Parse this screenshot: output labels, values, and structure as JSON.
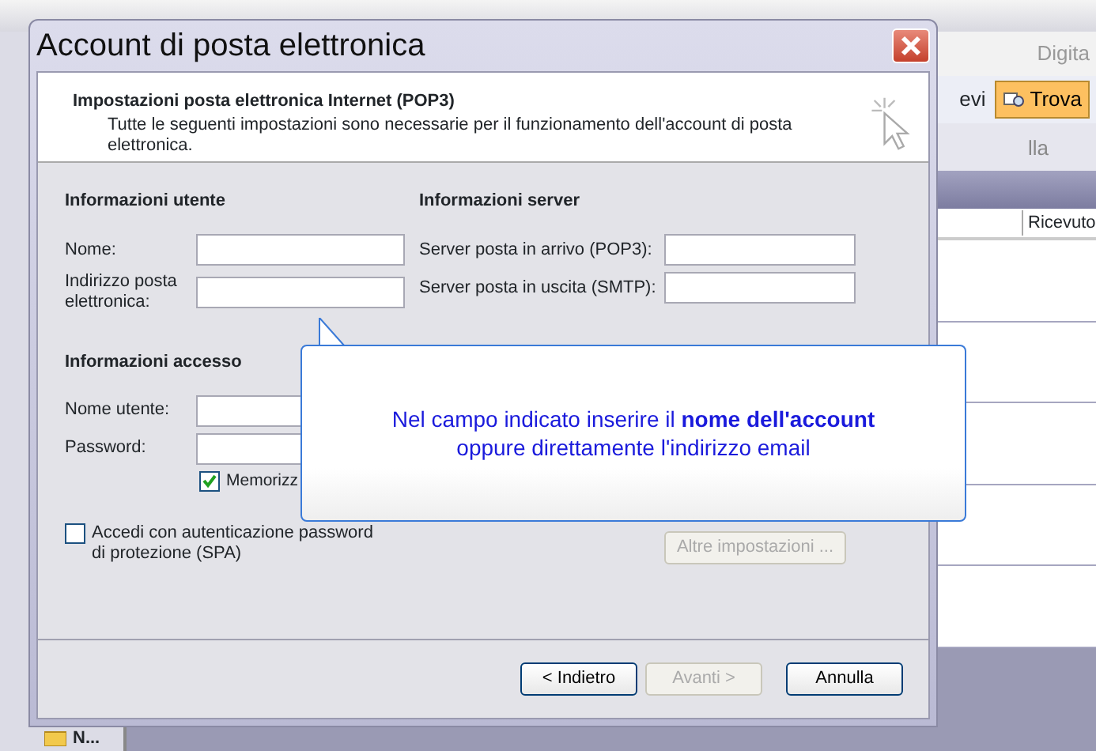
{
  "background_app": {
    "search_text": "Digita",
    "toolbar_item": "evi",
    "find_button": "Trova",
    "row_text": "lla",
    "column_header": "Ricevuto",
    "folder_label": "N..."
  },
  "window": {
    "title": "Account di posta elettronica"
  },
  "header": {
    "title": "Impostazioni posta elettronica Internet (POP3)",
    "subtitle": "Tutte le seguenti impostazioni sono necessarie per il funzionamento dell'account di posta elettronica."
  },
  "user_section": {
    "title": "Informazioni utente",
    "fields": [
      {
        "label": "Nome:"
      },
      {
        "label": "Indirizzo posta elettronica:"
      }
    ]
  },
  "server_section": {
    "title": "Informazioni server",
    "fields": [
      {
        "label": "Server posta in arrivo (POP3):"
      },
      {
        "label": "Server posta in uscita (SMTP):"
      }
    ]
  },
  "access_section": {
    "title": "Informazioni accesso",
    "fields": [
      {
        "label": "Nome utente:"
      },
      {
        "label": "Password:"
      }
    ],
    "remember": {
      "label": "Memorizz",
      "checked": true
    }
  },
  "spa": {
    "label": "Accedi con autenticazione password di protezione (SPA)",
    "checked": false
  },
  "more_settings": {
    "label": "Altre impostazioni ...",
    "disabled": true
  },
  "buttons": [
    {
      "label": "< Indietro",
      "disabled": false
    },
    {
      "label": "Avanti >",
      "disabled": true
    },
    {
      "label": "Annulla",
      "disabled": false
    }
  ],
  "callout": {
    "text": "Nel campo indicato inserire il **nome dell'account**\noppure direttamente l'indirizzo email"
  }
}
